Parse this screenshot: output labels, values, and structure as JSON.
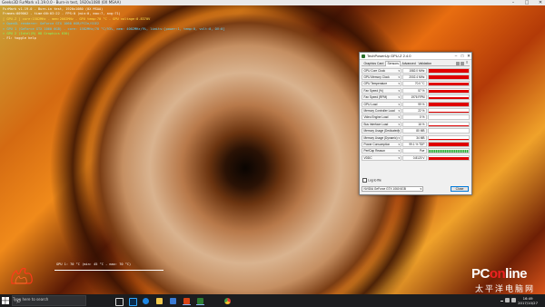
{
  "furmark": {
    "window_title": "Geeks3D FurMark v1.19.0.0 - Burn-in test, 1920x1080 (0X MSAA)",
    "info_lines": [
      {
        "text": "FurMark v1.19.0 - Burn-in test, 1920x1080 (0X MSAA)",
        "color": "white"
      },
      {
        "text": "Frames:009062 - time:00:03:22 - FPS:0 (min:0, max:7, avg:71)",
        "color": "white"
      },
      {
        "text": "[ GPU-Z ] core:1582MHz - mem:2002MHz - GPU temp:70 °C - GPU voltage:0.8370V",
        "color": "yellow"
      },
      {
        "text": "> OpenGL renderer: GeForce GTX 1060 6GB/PCIe/SSE2",
        "color": "cyan"
      },
      {
        "text": "> GPU 1 (GeForce GTX 1060 6GB) - core: 1582MHz/70 °C/93%, mem: 4002MHz/9%, limits:[power:1, temp:0, volt:0, OV:0]",
        "color": "cyan"
      },
      {
        "text": "> GPU 2 (Intel(R) HD Graphics 630)",
        "color": "green"
      },
      {
        "text": "- F1: toggle help",
        "color": "white"
      }
    ],
    "temp_graph_label": "GPU 1: 70 °C (min: 45 °C - max: 70 °C)"
  },
  "watermark": {
    "brand_main": "PConline",
    "brand_cn": "太平洋电脑网"
  },
  "gpuz": {
    "title": "TechPowerUp GPU-Z 2.4.0",
    "tabs": [
      "Graphics Card",
      "Sensors",
      "Advanced",
      "Validation"
    ],
    "active_tab": "Sensors",
    "rows": [
      {
        "label": "GPU Core Clock",
        "value": "1582.0 MHz",
        "level": 0.95,
        "style": "red"
      },
      {
        "label": "GPU Memory Clock",
        "value": "2002.4 MHz",
        "level": 0.95,
        "style": "red"
      },
      {
        "label": "GPU Temperature",
        "value": "70.0 °C",
        "level": 0.75,
        "style": "red"
      },
      {
        "label": "Fan Speed (%)",
        "value": "57 %",
        "level": 0.6,
        "style": "red"
      },
      {
        "label": "Fan Speed (RPM)",
        "value": "1976 RPM",
        "level": 0.6,
        "style": "red"
      },
      {
        "label": "GPU Load",
        "value": "99 %",
        "level": 0.98,
        "style": "red"
      },
      {
        "label": "Memory Controller Load",
        "value": "22 %",
        "level": 0.25,
        "style": "red"
      },
      {
        "label": "Video Engine Load",
        "value": "0 %",
        "level": 0.0,
        "style": "red"
      },
      {
        "label": "Bus Interface Load",
        "value": "16 %",
        "level": 0.12,
        "style": "red"
      },
      {
        "label": "Memory Usage (Dedicated)",
        "value": "80 MB",
        "level": 0.05,
        "style": "red"
      },
      {
        "label": "Memory Usage (Dynamic)",
        "value": "34 MB",
        "level": 0.05,
        "style": "red"
      },
      {
        "label": "Power Consumption",
        "value": "99.1 % TDP",
        "level": 0.95,
        "style": "red"
      },
      {
        "label": "PerfCap Reason",
        "value": "Pwr",
        "level": 0.9,
        "style": "green"
      },
      {
        "label": "VDDC",
        "value": "0.8120 V",
        "level": 0.7,
        "style": "red"
      }
    ],
    "log_to_file": "Log to file",
    "gpu_select": "NVIDIA GeForce GTX 1060 6GB",
    "close_button": "Close"
  },
  "taskbar": {
    "search_placeholder": "Type here to search",
    "apps": [
      "task-view",
      "photoshop",
      "edge",
      "file-explorer",
      "store",
      "furmark",
      "gpu-z",
      "chrome"
    ],
    "clock_time": "16:49",
    "clock_date": "2017/10/27"
  }
}
